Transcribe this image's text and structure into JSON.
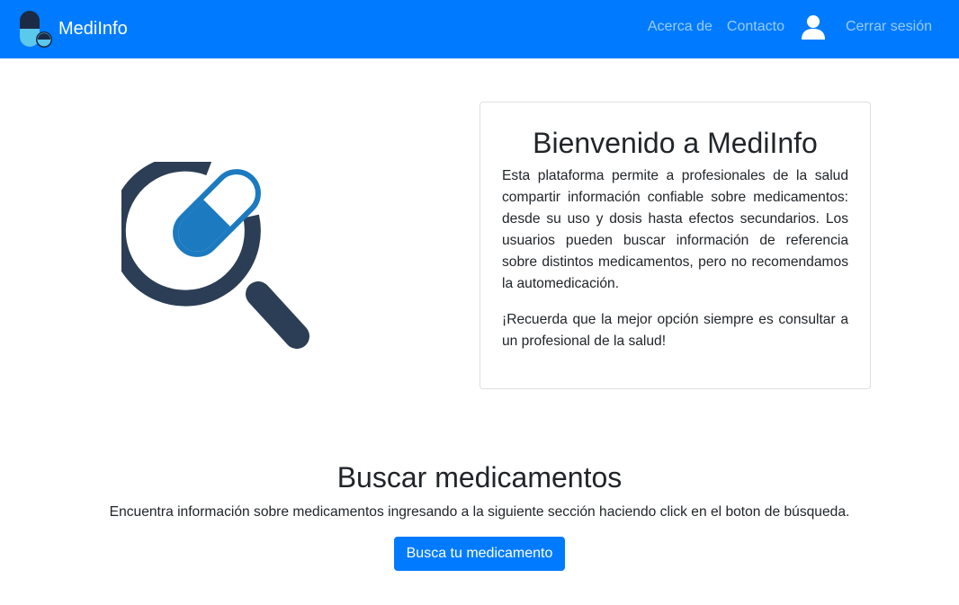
{
  "colors": {
    "navbar_bg": "#007bff",
    "primary": "#007bff",
    "illustration_dark": "#2c3e55",
    "illustration_blue": "#1b7ac0"
  },
  "navbar": {
    "brand": "MediInfo",
    "brand_logo_icon": "pill-capsule-logo-icon",
    "links": {
      "about": "Acerca de",
      "contact": "Contacto",
      "user_icon": "user-icon",
      "logout": "Cerrar sesión"
    }
  },
  "hero": {
    "illustration_icon": "magnifier-pill-icon",
    "card": {
      "title": "Bienvenido a MediInfo",
      "paragraph_1": "Esta plataforma permite a profesionales de la salud compartir información confiable sobre medicamentos: desde su uso y dosis hasta efectos secundarios. Los usuarios pueden buscar información de referencia sobre distintos medicamentos, pero no recomendamos la automedicación.",
      "paragraph_2": "¡Recuerda que la mejor opción siempre es consultar a un profesional de la salud!"
    }
  },
  "search_section": {
    "title": "Buscar medicamentos",
    "description": "Encuentra información sobre medicamentos ingresando a la siguiente sección haciendo click en el boton de búsqueda.",
    "button_label": "Busca tu medicamento"
  }
}
